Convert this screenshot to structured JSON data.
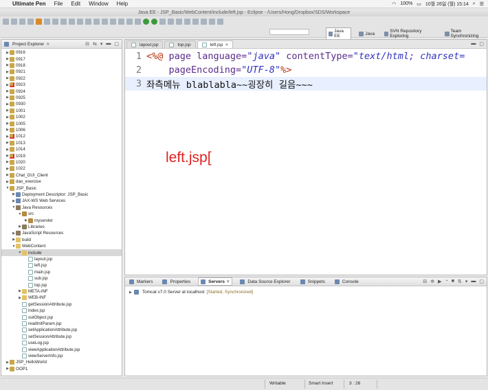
{
  "menubar": {
    "app": "Ultimate Pen",
    "items": [
      "File",
      "Edit",
      "Window",
      "Help"
    ],
    "battery": "100%",
    "datetime": "10월 26일 (월)  15:14"
  },
  "window": {
    "title": "Java EE - JSP_Basic/WebContent/include/left.jsp - Eclipse - /Users/Hong/Dropbox/SDS/Workspace"
  },
  "perspectives": [
    {
      "label": "Java EE",
      "active": true
    },
    {
      "label": "Java",
      "active": false
    },
    {
      "label": "SVN Repository Exploring",
      "active": false
    },
    {
      "label": "Team Synchronizing",
      "active": false
    }
  ],
  "explorer": {
    "title": "Project Explorer",
    "rows": [
      {
        "label": "0916",
        "depth": 0,
        "arrow": "▶",
        "icon": "proj"
      },
      {
        "label": "0917",
        "depth": 0,
        "arrow": "▶",
        "icon": "proj"
      },
      {
        "label": "0918",
        "depth": 0,
        "arrow": "▶",
        "icon": "proj"
      },
      {
        "label": "0921",
        "depth": 0,
        "arrow": "▶",
        "icon": "proj"
      },
      {
        "label": "0922",
        "depth": 0,
        "arrow": "▶",
        "icon": "proj"
      },
      {
        "label": "0923",
        "depth": 0,
        "arrow": "▶",
        "icon": "err"
      },
      {
        "label": "0924",
        "depth": 0,
        "arrow": "▶",
        "icon": "proj"
      },
      {
        "label": "0925",
        "depth": 0,
        "arrow": "▶",
        "icon": "proj"
      },
      {
        "label": "0930",
        "depth": 0,
        "arrow": "▶",
        "icon": "proj"
      },
      {
        "label": "1001",
        "depth": 0,
        "arrow": "▶",
        "icon": "proj"
      },
      {
        "label": "1002",
        "depth": 0,
        "arrow": "▶",
        "icon": "proj"
      },
      {
        "label": "1005",
        "depth": 0,
        "arrow": "▶",
        "icon": "proj"
      },
      {
        "label": "1006",
        "depth": 0,
        "arrow": "▶",
        "icon": "proj"
      },
      {
        "label": "1012",
        "depth": 0,
        "arrow": "▶",
        "icon": "err"
      },
      {
        "label": "1013",
        "depth": 0,
        "arrow": "▶",
        "icon": "proj"
      },
      {
        "label": "1014",
        "depth": 0,
        "arrow": "▶",
        "icon": "proj"
      },
      {
        "label": "1019",
        "depth": 0,
        "arrow": "▶",
        "icon": "err"
      },
      {
        "label": "1020",
        "depth": 0,
        "arrow": "▶",
        "icon": "proj"
      },
      {
        "label": "1022",
        "depth": 0,
        "arrow": "▶",
        "icon": "proj"
      },
      {
        "label": "Chat_GUI_Client",
        "depth": 0,
        "arrow": "▶",
        "icon": "proj"
      },
      {
        "label": "dao_exercise",
        "depth": 0,
        "arrow": "▶",
        "icon": "proj"
      },
      {
        "label": "JSP_Basic",
        "depth": 0,
        "arrow": "▼",
        "icon": "proj"
      },
      {
        "label": "Deployment Descriptor: JSP_Basic",
        "depth": 1,
        "arrow": "▶",
        "icon": "desc"
      },
      {
        "label": "JAX-WS Web Services",
        "depth": 1,
        "arrow": "▶",
        "icon": "desc"
      },
      {
        "label": "Java Resources",
        "depth": 1,
        "arrow": "▼",
        "icon": "lib"
      },
      {
        "label": "src",
        "depth": 2,
        "arrow": "▼",
        "icon": "pkg"
      },
      {
        "label": "myservlet",
        "depth": 3,
        "arrow": "▶",
        "icon": "pkg"
      },
      {
        "label": "Libraries",
        "depth": 2,
        "arrow": "▶",
        "icon": "lib"
      },
      {
        "label": "JavaScript Resources",
        "depth": 1,
        "arrow": "▶",
        "icon": "lib"
      },
      {
        "label": "build",
        "depth": 1,
        "arrow": "▶",
        "icon": "fold"
      },
      {
        "label": "WebContent",
        "depth": 1,
        "arrow": "▼",
        "icon": "fold"
      },
      {
        "label": "include",
        "depth": 2,
        "arrow": "▼",
        "icon": "fold",
        "selected": true
      },
      {
        "label": "layout.jsp",
        "depth": 3,
        "arrow": "",
        "icon": "file"
      },
      {
        "label": "left.jsp",
        "depth": 3,
        "arrow": "",
        "icon": "file"
      },
      {
        "label": "main.jsp",
        "depth": 3,
        "arrow": "",
        "icon": "file"
      },
      {
        "label": "sub.jsp",
        "depth": 3,
        "arrow": "",
        "icon": "file"
      },
      {
        "label": "top.jsp",
        "depth": 3,
        "arrow": "",
        "icon": "file"
      },
      {
        "label": "META-INF",
        "depth": 2,
        "arrow": "▶",
        "icon": "fold"
      },
      {
        "label": "WEB-INF",
        "depth": 2,
        "arrow": "▶",
        "icon": "fold"
      },
      {
        "label": "getSessionAttribute.jsp",
        "depth": 2,
        "arrow": "",
        "icon": "file"
      },
      {
        "label": "index.jsp",
        "depth": 2,
        "arrow": "",
        "icon": "file"
      },
      {
        "label": "outObject.jsp",
        "depth": 2,
        "arrow": "",
        "icon": "file"
      },
      {
        "label": "readInitParam.jsp",
        "depth": 2,
        "arrow": "",
        "icon": "file"
      },
      {
        "label": "setApplicationAttribute.jsp",
        "depth": 2,
        "arrow": "",
        "icon": "file"
      },
      {
        "label": "setSessionAttribute.jsp",
        "depth": 2,
        "arrow": "",
        "icon": "file"
      },
      {
        "label": "useLog.jsp",
        "depth": 2,
        "arrow": "",
        "icon": "file"
      },
      {
        "label": "viewApplicationAttribute.jsp",
        "depth": 2,
        "arrow": "",
        "icon": "file"
      },
      {
        "label": "viewServerInfo.jsp",
        "depth": 2,
        "arrow": "",
        "icon": "file"
      },
      {
        "label": "JSP_HelloWorld",
        "depth": 0,
        "arrow": "▶",
        "icon": "proj"
      },
      {
        "label": "OOP1",
        "depth": 0,
        "arrow": "▶",
        "icon": "proj"
      }
    ]
  },
  "editor": {
    "tabs": [
      {
        "label": "layout.jsp",
        "active": false
      },
      {
        "label": "top.jsp",
        "active": false
      },
      {
        "label": "left.jsp",
        "active": true
      }
    ],
    "lines": [
      {
        "num": "1",
        "tokens": [
          {
            "t": "<%@ ",
            "c": "tag"
          },
          {
            "t": "page ",
            "c": "kw"
          },
          {
            "t": "language=",
            "c": "attr"
          },
          {
            "t": "\"java\" ",
            "c": "val"
          },
          {
            "t": "contentType=",
            "c": "attr"
          },
          {
            "t": "\"text/html; charset=",
            "c": "val"
          }
        ]
      },
      {
        "num": "2",
        "tokens": [
          {
            "t": "    pageEncoding=",
            "c": "attr"
          },
          {
            "t": "\"UTF-8\"",
            "c": "val"
          },
          {
            "t": "%>",
            "c": "tag"
          }
        ]
      },
      {
        "num": "3",
        "current": true,
        "tokens": [
          {
            "t": "좌측메뉴 blablabla~~굉장히 길음~~~",
            "c": "text"
          }
        ]
      }
    ],
    "overlay_text": "left.jsp["
  },
  "bottom": {
    "tabs": [
      {
        "label": "Markers",
        "active": false
      },
      {
        "label": "Properties",
        "active": false
      },
      {
        "label": "Servers",
        "active": true
      },
      {
        "label": "Data Source Explorer",
        "active": false
      },
      {
        "label": "Snippets",
        "active": false
      },
      {
        "label": "Console",
        "active": false
      }
    ],
    "server_name": "Tomcat v7.0 Server at localhost",
    "server_state": "[Started, Synchronized]"
  },
  "status": {
    "mode": "Writable",
    "insert": "Smart Insert",
    "position": "3 : 26"
  }
}
